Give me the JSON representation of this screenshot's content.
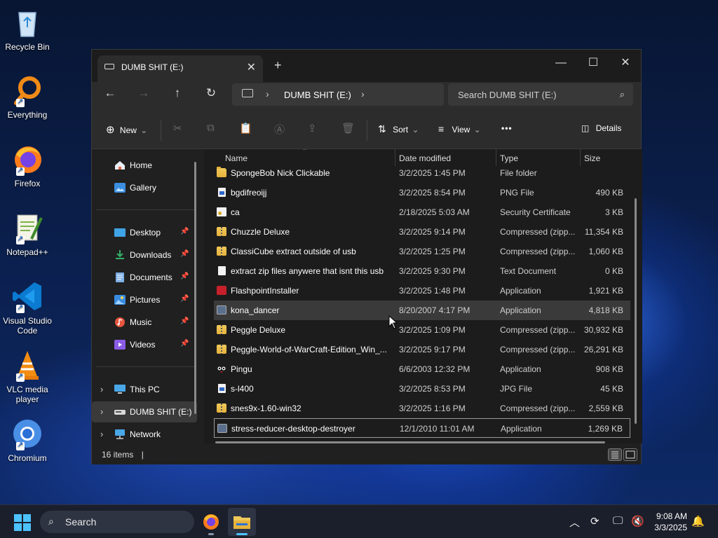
{
  "desktop": {
    "icons": [
      {
        "label": "Recycle Bin"
      },
      {
        "label": "Everything"
      },
      {
        "label": "Firefox"
      },
      {
        "label": "Notepad++"
      },
      {
        "label": "Visual Studio Code"
      },
      {
        "label": "VLC media player"
      },
      {
        "label": "Chromium"
      }
    ]
  },
  "window": {
    "tab_title": "DUMB SHIT (E:)",
    "tab_close": "✕",
    "new_tab": "+",
    "controls": {
      "minimize": "—",
      "maximize": "☐",
      "close": "✕"
    },
    "nav": {
      "back": "←",
      "forward": "→",
      "up": "↑",
      "refresh": "↻"
    },
    "address": {
      "segment": "DUMB SHIT (E:)",
      "chevron": "›"
    },
    "search": {
      "placeholder": "Search DUMB SHIT (E:)",
      "icon": "⌕"
    }
  },
  "toolbar": {
    "new_label": "New",
    "new_icon": "⊕",
    "sort_label": "Sort",
    "sort_icon": "⇅",
    "view_label": "View",
    "view_icon": "≡",
    "more_icon": "•••",
    "details_label": "Details",
    "details_icon": "◫",
    "dropdown": "⌄",
    "cut_icon": "✂",
    "copy_icon": "⧉",
    "paste_icon": "📋",
    "rename_icon": "Ⓐ",
    "share_icon": "⇪",
    "delete_icon": "🗑"
  },
  "sidebar": {
    "home": "Home",
    "gallery": "Gallery",
    "quick": [
      {
        "label": "Desktop"
      },
      {
        "label": "Downloads"
      },
      {
        "label": "Documents"
      },
      {
        "label": "Pictures"
      },
      {
        "label": "Music"
      },
      {
        "label": "Videos"
      }
    ],
    "pin_icon": "📌",
    "expand_icon": "›",
    "this_pc": "This PC",
    "drive": "DUMB SHIT (E:)",
    "network": "Network"
  },
  "columns": {
    "name": "Name",
    "date": "Date modified",
    "type": "Type",
    "size": "Size",
    "sort_indicator": "^"
  },
  "files": [
    {
      "name": "SpongeBob Nick Clickable",
      "date": "3/2/2025 1:45 PM",
      "type": "File folder",
      "size": "",
      "icon": "folder"
    },
    {
      "name": "bgdifreoijj",
      "date": "3/2/2025 8:54 PM",
      "type": "PNG File",
      "size": "490 KB",
      "icon": "png"
    },
    {
      "name": "ca",
      "date": "2/18/2025 5:03 AM",
      "type": "Security Certificate",
      "size": "3 KB",
      "icon": "cert"
    },
    {
      "name": "Chuzzle Deluxe",
      "date": "3/2/2025 9:14 PM",
      "type": "Compressed (zipp...",
      "size": "11,354 KB",
      "icon": "zip"
    },
    {
      "name": "ClassiCube extract outside of usb",
      "date": "3/2/2025 1:25 PM",
      "type": "Compressed (zipp...",
      "size": "1,060 KB",
      "icon": "zip"
    },
    {
      "name": "extract zip files anywere that isnt this usb",
      "date": "3/2/2025 9:30 PM",
      "type": "Text Document",
      "size": "0 KB",
      "icon": "doc"
    },
    {
      "name": "FlashpointInstaller",
      "date": "3/2/2025 1:48 PM",
      "type": "Application",
      "size": "1,921 KB",
      "icon": "app-red"
    },
    {
      "name": "kona_dancer",
      "date": "8/20/2007 4:17 PM",
      "type": "Application",
      "size": "4,818 KB",
      "icon": "app-gen"
    },
    {
      "name": "Peggle Deluxe",
      "date": "3/2/2025 1:09 PM",
      "type": "Compressed (zipp...",
      "size": "30,932 KB",
      "icon": "zip"
    },
    {
      "name": "Peggle-World-of-WarCraft-Edition_Win_...",
      "date": "3/2/2025 9:17 PM",
      "type": "Compressed (zipp...",
      "size": "26,291 KB",
      "icon": "zip"
    },
    {
      "name": "Pingu",
      "date": "6/6/2003 12:32 PM",
      "type": "Application",
      "size": "908 KB",
      "icon": "app-pingu"
    },
    {
      "name": "s-l400",
      "date": "3/2/2025 8:53 PM",
      "type": "JPG File",
      "size": "45 KB",
      "icon": "png"
    },
    {
      "name": "snes9x-1.60-win32",
      "date": "3/2/2025 1:16 PM",
      "type": "Compressed (zipp...",
      "size": "2,559 KB",
      "icon": "zip"
    },
    {
      "name": "stress-reducer-desktop-destroyer",
      "date": "12/1/2010 11:01 AM",
      "type": "Application",
      "size": "1,269 KB",
      "icon": "app-gen"
    }
  ],
  "status": {
    "count": "16 items",
    "sep": "|"
  },
  "taskbar": {
    "search_label": "Search",
    "search_icon": "⌕",
    "tray": {
      "chevron": "︿",
      "sync": "⟳",
      "network": "🖵",
      "volume": "🔇",
      "bell": "🔔"
    },
    "time": "9:08 AM",
    "date": "3/3/2025"
  }
}
